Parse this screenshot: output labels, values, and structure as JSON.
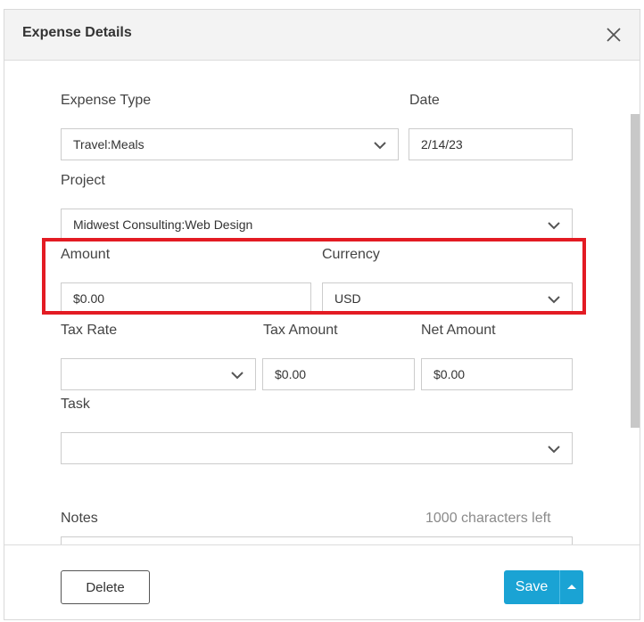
{
  "dialog": {
    "title": "Expense Details"
  },
  "form": {
    "expense_type": {
      "label": "Expense Type",
      "value": "Travel:Meals"
    },
    "date": {
      "label": "Date",
      "value": "2/14/23"
    },
    "project": {
      "label": "Project",
      "value": "Midwest Consulting:Web Design"
    },
    "amount": {
      "label": "Amount",
      "value": "$0.00"
    },
    "currency": {
      "label": "Currency",
      "value": "USD"
    },
    "tax_rate": {
      "label": "Tax Rate",
      "value": ""
    },
    "tax_amount": {
      "label": "Tax Amount",
      "value": "$0.00"
    },
    "net_amount": {
      "label": "Net Amount",
      "value": "$0.00"
    },
    "task": {
      "label": "Task",
      "value": ""
    },
    "notes": {
      "label": "Notes",
      "counter": "1000 characters left",
      "value": ""
    }
  },
  "footer": {
    "delete_label": "Delete",
    "save_label": "Save"
  },
  "colors": {
    "highlight": "#e31b23",
    "save_button": "#1aa3d4"
  },
  "icons": {
    "close": "close-icon",
    "dropdown": "chevron-down-icon",
    "split": "caret-up-icon"
  }
}
